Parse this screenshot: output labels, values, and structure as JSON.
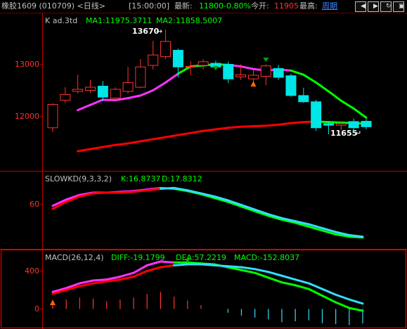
{
  "header": {
    "title": "橡胶1609 (010709) <日线>",
    "time": "[15:00:00]",
    "latest_label": "最新:",
    "latest_value": "11800",
    "change_pct": "-0.80%",
    "open_label": "今开:",
    "open_value": "11905",
    "high_label": "最高:",
    "period": "周期",
    "colors": {
      "up": "#ff3232",
      "down": "#00e6e6",
      "text": "#c0c0c0",
      "accent": "#00ff00"
    }
  },
  "panels": {
    "kline": {
      "title": "K  ad.3td",
      "ma1_label": "MA1:11975.3711",
      "ma2_label": "MA2:11858.5007",
      "y_ticks": [
        "13000",
        "12000"
      ],
      "high_marker": "13670",
      "low_marker": "11655"
    },
    "kd": {
      "title": "SLOWKD(9,3,3,2)",
      "k_label": "K:16.8737",
      "d_label": "D:17.8312",
      "y_ticks": [
        "60"
      ]
    },
    "macd": {
      "title": "MACD(26,12,4)",
      "diff_label": "DIFF:-19.1799",
      "dea_label": "DEA:57.2219",
      "macd_label": "MACD:-152.8037",
      "y_ticks": [
        "400",
        "0"
      ]
    }
  },
  "chart_data": [
    {
      "type": "candlestick",
      "title": "K  ad.3td",
      "ylim": [
        11400,
        13900
      ],
      "candles": [
        {
          "o": 11780,
          "h": 12250,
          "l": 11700,
          "c": 12230
        },
        {
          "o": 12310,
          "h": 12560,
          "l": 12250,
          "c": 12420
        },
        {
          "o": 12480,
          "h": 12800,
          "l": 12440,
          "c": 12520
        },
        {
          "o": 12500,
          "h": 12700,
          "l": 12450,
          "c": 12560
        },
        {
          "o": 12580,
          "h": 12680,
          "l": 12290,
          "c": 12370
        },
        {
          "o": 12350,
          "h": 12560,
          "l": 12300,
          "c": 12520
        },
        {
          "o": 12480,
          "h": 12950,
          "l": 12440,
          "c": 12650
        },
        {
          "o": 12560,
          "h": 13100,
          "l": 12540,
          "c": 12950
        },
        {
          "o": 12980,
          "h": 13450,
          "l": 12900,
          "c": 13180
        },
        {
          "o": 13150,
          "h": 13670,
          "l": 13100,
          "c": 13440
        },
        {
          "o": 13270,
          "h": 13300,
          "l": 12750,
          "c": 12950
        },
        {
          "o": 12950,
          "h": 13060,
          "l": 12800,
          "c": 12960
        },
        {
          "o": 12980,
          "h": 13100,
          "l": 12900,
          "c": 13050
        },
        {
          "o": 13020,
          "h": 13070,
          "l": 12900,
          "c": 12950
        },
        {
          "o": 13000,
          "h": 13050,
          "l": 12640,
          "c": 12720
        },
        {
          "o": 12760,
          "h": 13000,
          "l": 12700,
          "c": 12800
        },
        {
          "o": 12720,
          "h": 12900,
          "l": 12650,
          "c": 12790
        },
        {
          "o": 12770,
          "h": 13000,
          "l": 12600,
          "c": 12970
        },
        {
          "o": 12920,
          "h": 12990,
          "l": 12700,
          "c": 12750
        },
        {
          "o": 12780,
          "h": 12820,
          "l": 12380,
          "c": 12400
        },
        {
          "o": 12400,
          "h": 12550,
          "l": 12260,
          "c": 12280
        },
        {
          "o": 12280,
          "h": 12320,
          "l": 11720,
          "c": 11780
        },
        {
          "o": 11860,
          "h": 11900,
          "l": 11655,
          "c": 11830
        },
        {
          "o": 11830,
          "h": 11900,
          "l": 11730,
          "c": 11860
        },
        {
          "o": 11900,
          "h": 11960,
          "l": 11690,
          "c": 11780
        },
        {
          "o": 11905,
          "h": 11950,
          "l": 11750,
          "c": 11800
        }
      ],
      "series": [
        {
          "name": "MA1",
          "values": [
            null,
            null,
            12120,
            12220,
            12320,
            12310,
            12350,
            12400,
            12500,
            12650,
            12820,
            12960,
            12980,
            13000,
            12990,
            12960,
            12910,
            12880,
            12900,
            12880,
            12800,
            12650,
            12480,
            12300,
            12150,
            11975
          ]
        },
        {
          "name": "MA2",
          "values": [
            null,
            null,
            11330,
            11370,
            11410,
            11450,
            11480,
            11520,
            11560,
            11600,
            11640,
            11680,
            11720,
            11750,
            11780,
            11800,
            11810,
            11820,
            11840,
            11870,
            11890,
            11900,
            11890,
            11880,
            11870,
            11858
          ]
        }
      ],
      "high_marker": 13670,
      "low_marker": 11655
    },
    {
      "type": "line",
      "title": "SLOWKD(9,3,3,2)",
      "ylim": [
        12,
        96
      ],
      "series": [
        {
          "name": "K",
          "values": [
            58,
            66,
            72,
            75,
            75,
            76,
            77,
            79,
            81,
            80,
            77,
            73,
            68,
            63,
            57,
            51,
            45,
            40,
            36,
            31,
            26,
            21,
            18,
            17
          ]
        },
        {
          "name": "D",
          "values": [
            54,
            63,
            70,
            74,
            75,
            75,
            76,
            78,
            80,
            81,
            78,
            74,
            70,
            65,
            59,
            53,
            47,
            42,
            38,
            34,
            29,
            24,
            20,
            18
          ]
        }
      ]
    },
    {
      "type": "line",
      "title": "MACD(26,12,4)",
      "ylim": [
        -250,
        650
      ],
      "series": [
        {
          "name": "DIFF",
          "values": [
            180,
            220,
            270,
            300,
            310,
            340,
            380,
            460,
            500,
            490,
            490,
            480,
            470,
            440,
            410,
            380,
            330,
            280,
            250,
            210,
            140,
            70,
            10,
            -19
          ]
        },
        {
          "name": "DEA",
          "values": [
            160,
            200,
            240,
            270,
            290,
            310,
            340,
            400,
            440,
            460,
            470,
            470,
            460,
            450,
            440,
            420,
            390,
            350,
            310,
            270,
            210,
            150,
            100,
            57
          ]
        },
        {
          "name": "MACD",
          "values": [
            60,
            100,
            120,
            110,
            80,
            100,
            120,
            160,
            180,
            130,
            90,
            40,
            0,
            -40,
            -70,
            -90,
            -110,
            -140,
            -130,
            -120,
            -150,
            -160,
            -170,
            -152
          ]
        }
      ]
    }
  ]
}
